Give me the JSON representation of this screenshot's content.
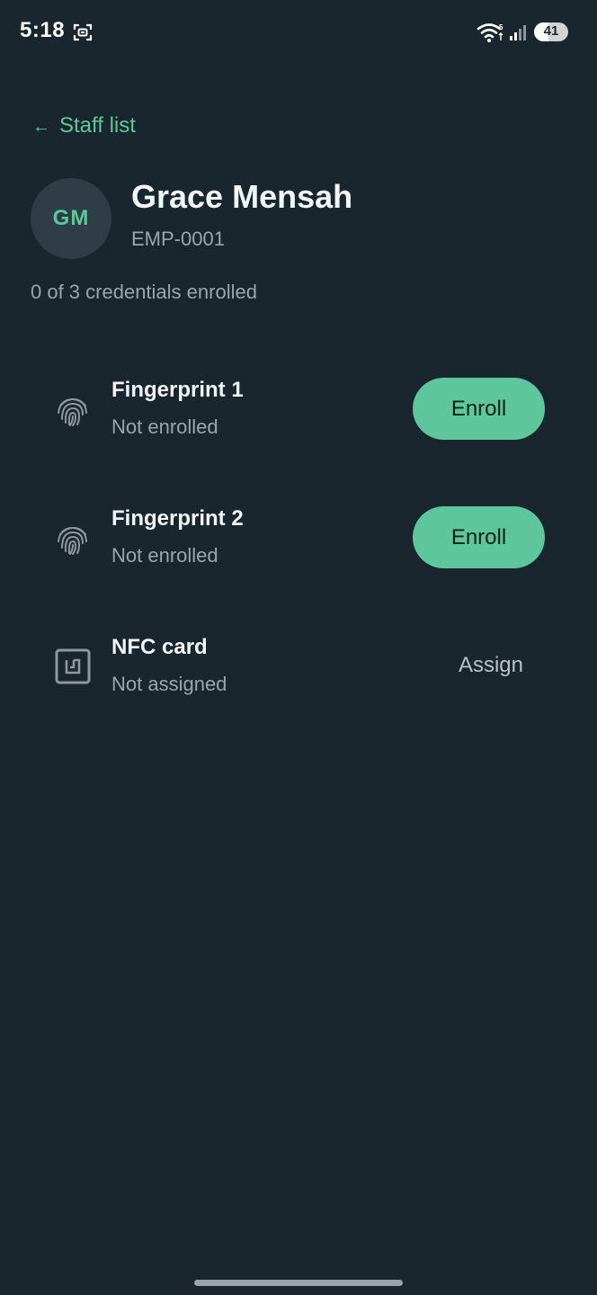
{
  "status_bar": {
    "time": "5:18",
    "battery_level": "41",
    "battery_fraction": 0.41,
    "icons": [
      "screen-record-icon",
      "wifi-icon",
      "signal-icon",
      "battery-icon"
    ]
  },
  "navigation": {
    "back_arrow": "←",
    "back_label": "Staff list"
  },
  "employee": {
    "initials": "GM",
    "name": "Grace Mensah",
    "id": "EMP-0001",
    "credentials_summary": "0 of 3 credentials enrolled"
  },
  "credentials": [
    {
      "title": "Fingerprint 1",
      "status": "Not enrolled",
      "action": "Enroll",
      "icon": "fingerprint-icon"
    },
    {
      "title": "Fingerprint 2",
      "status": "Not enrolled",
      "action": "Enroll",
      "icon": "fingerprint-icon"
    },
    {
      "title": "NFC card",
      "status": "Not assigned",
      "action": "Assign",
      "icon": "nfc-card-icon"
    }
  ],
  "colors": {
    "background": "#1a262e",
    "accent": "#5ec69c",
    "secondary_text": "#9aa6ad",
    "avatar_bg": "#2f3d47"
  }
}
